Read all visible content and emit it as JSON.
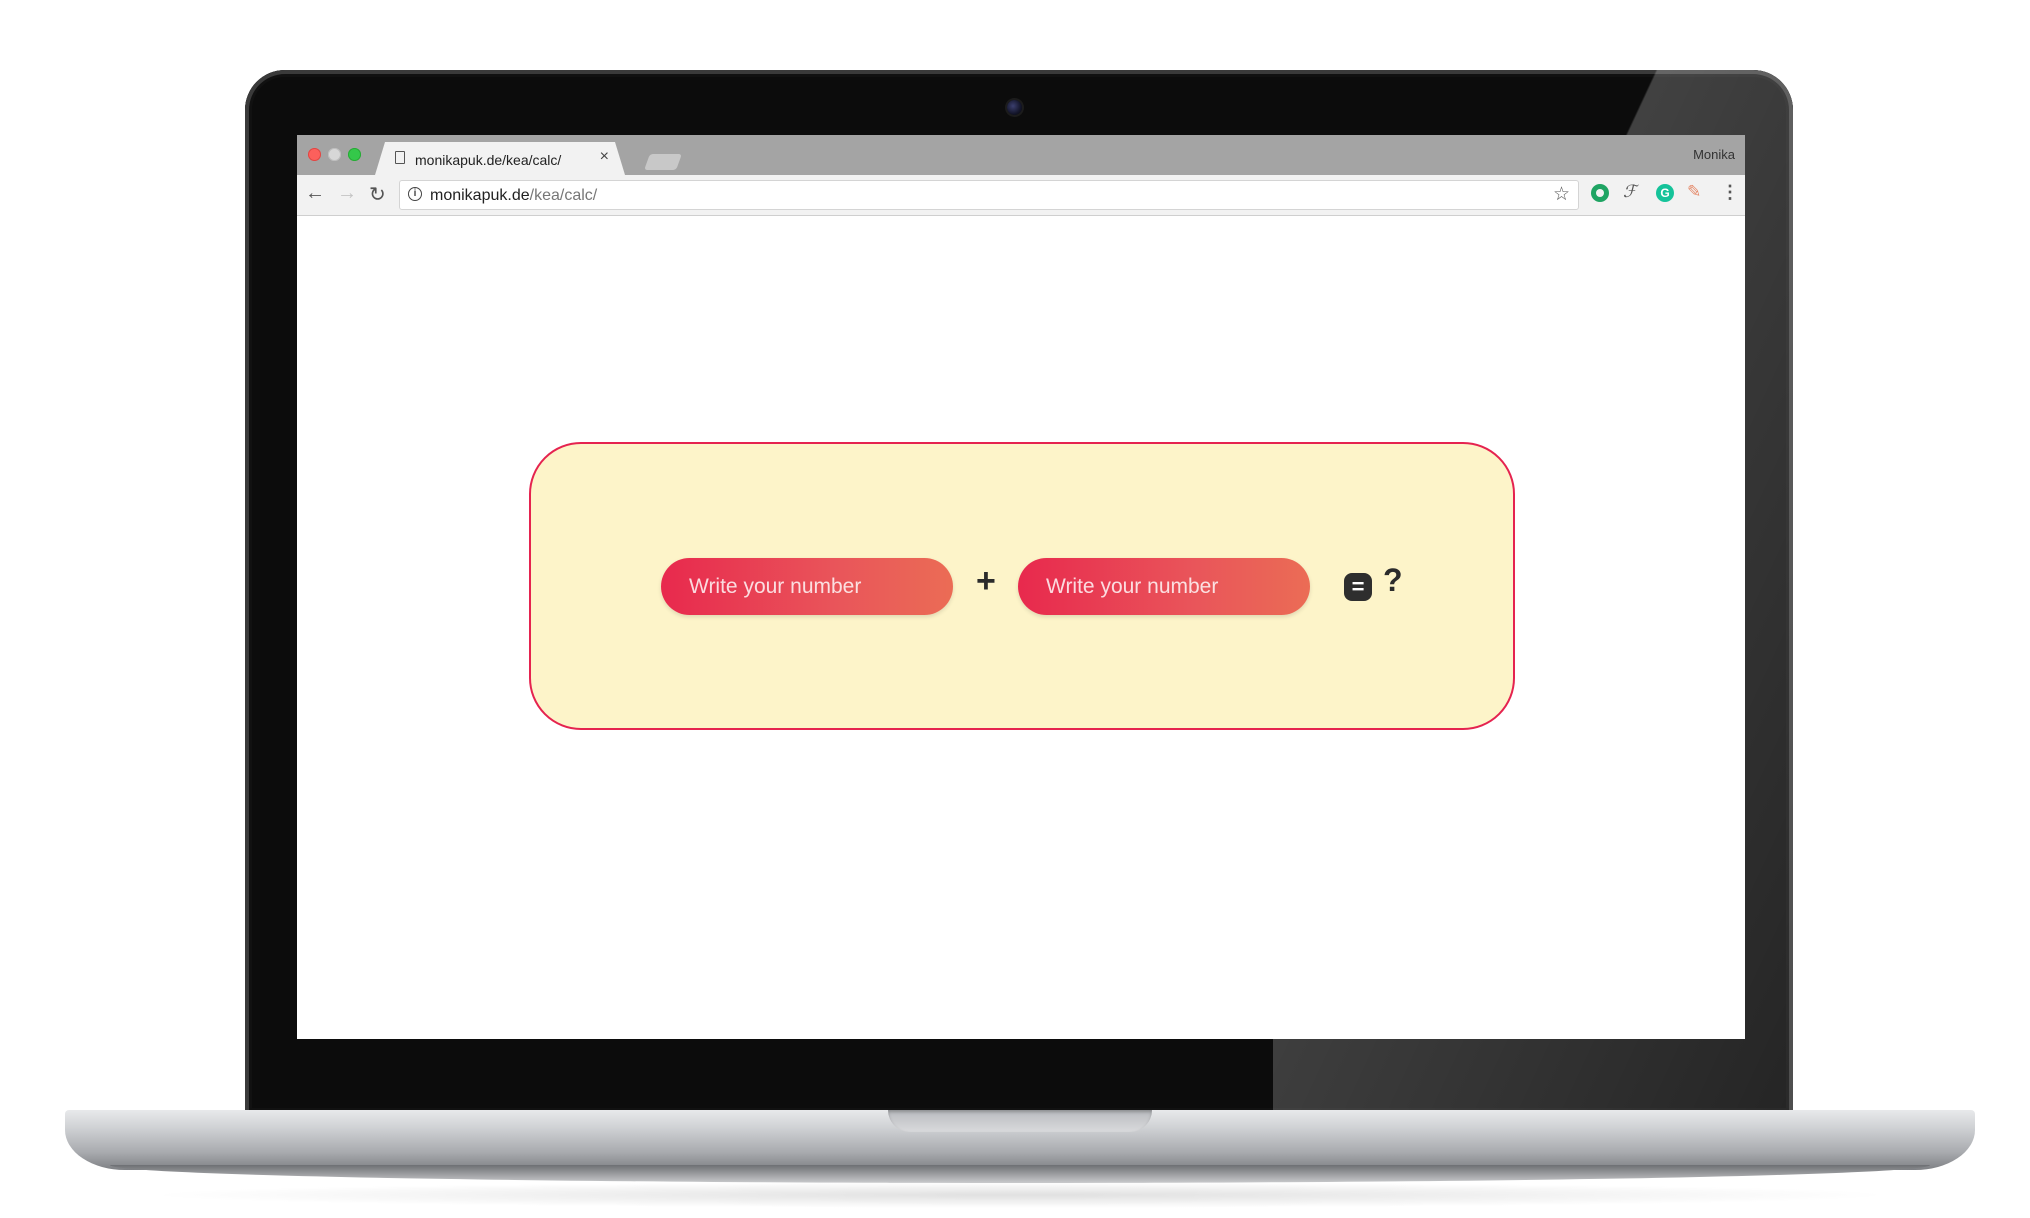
{
  "browser": {
    "tab_title": "monikapuk.de/kea/calc/",
    "tab_close": "×",
    "profile_name": "Monika",
    "url_host": "monikapuk.de",
    "url_path": "/kea/calc/",
    "nav": {
      "back": "←",
      "forward": "→",
      "reload": "↻"
    },
    "info_icon": "i",
    "star_icon": "☆",
    "menu_icon": "⋮",
    "extensions": [
      "grammarly-icon",
      "typography-icon",
      "grammarly-g-icon",
      "eyedropper-icon"
    ],
    "ext_labels": {
      "grammarly_g": "G",
      "typography": "ℱ",
      "eyedropper": "✎"
    }
  },
  "calculator": {
    "input_1_placeholder": "Write your number",
    "input_2_placeholder": "Write your number",
    "operator": "+",
    "equals_label": "=",
    "result": "?"
  },
  "colors": {
    "card_background": "#fdf4c9",
    "card_border": "#e5234f",
    "input_gradient_start": "#e8294d",
    "input_gradient_end": "#eb6c55"
  }
}
